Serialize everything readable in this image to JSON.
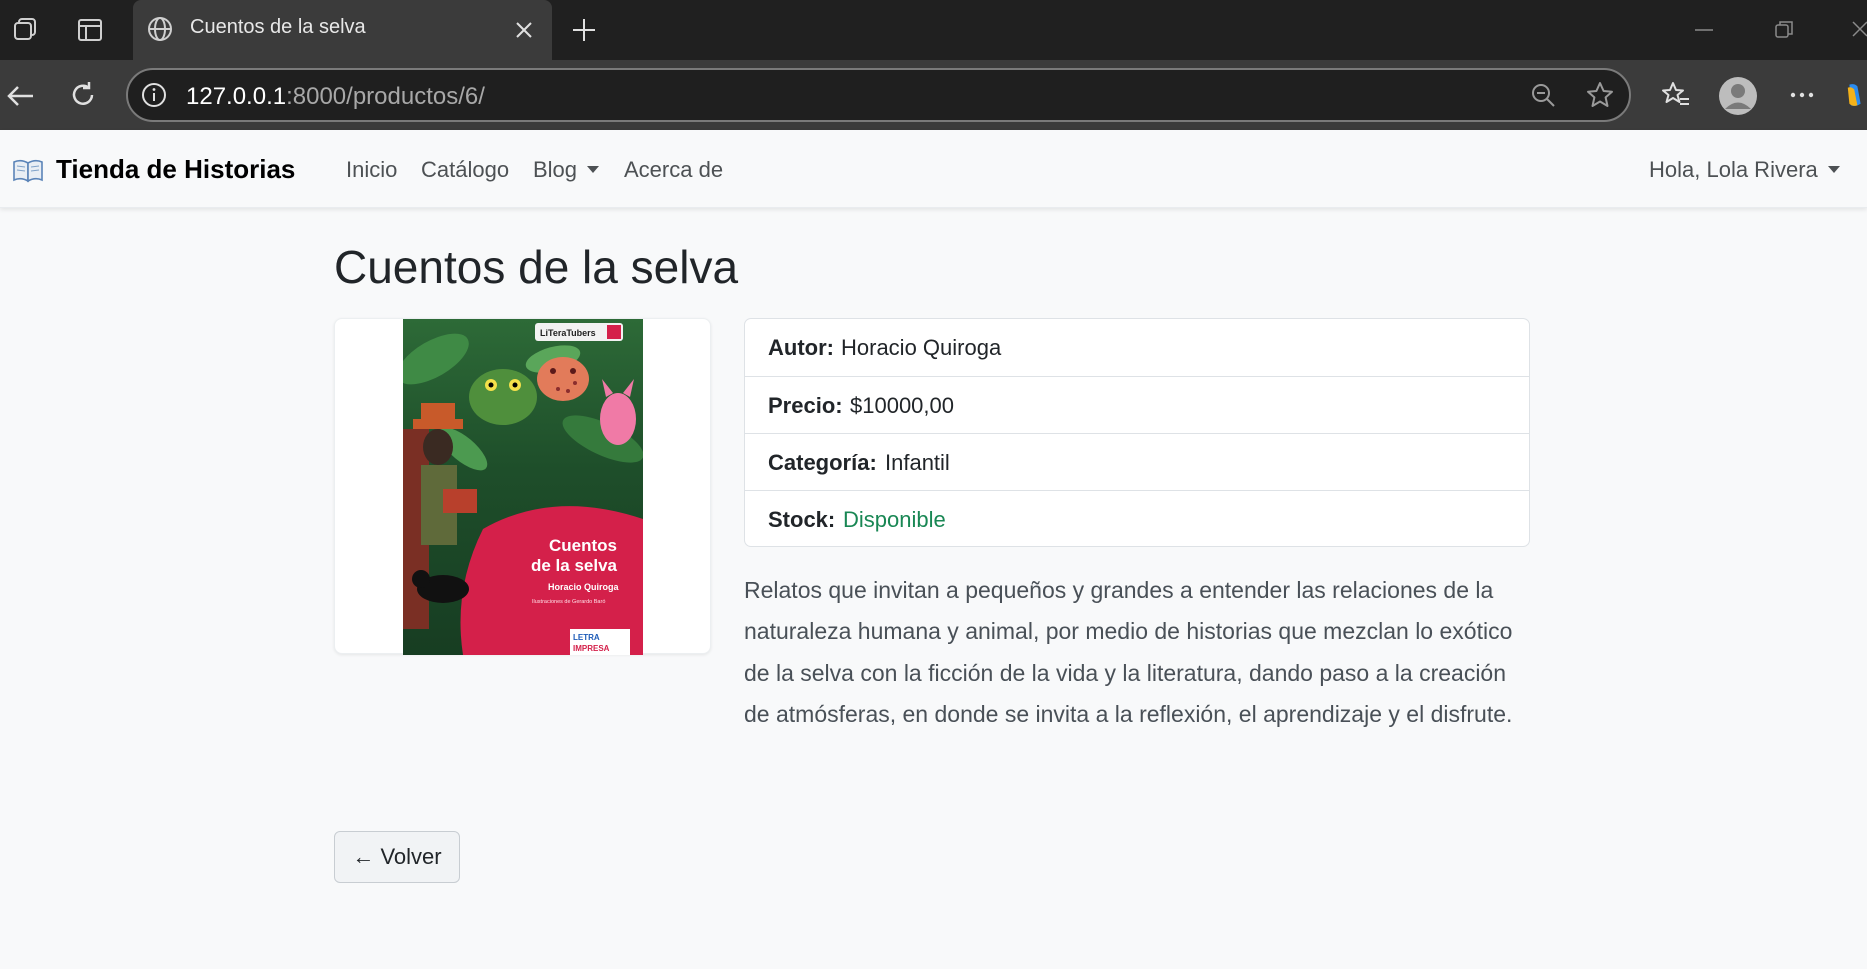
{
  "browser": {
    "tab_title": "Cuentos de la selva",
    "url_host": "127.0.0.1",
    "url_rest": ":8000/productos/6/"
  },
  "navbar": {
    "brand": "Tienda de Historias",
    "links": [
      "Inicio",
      "Catálogo",
      "Blog",
      "Acerca de"
    ],
    "user_menu": "Hola, Lola Rivera"
  },
  "product": {
    "title": "Cuentos de la selva",
    "cover": {
      "badge": "LiTeraTubers",
      "title_line1": "Cuentos",
      "title_line2": "de la selva",
      "author": "Horacio Quiroga",
      "illustrator": "Ilustraciones de Gerardo Baró",
      "publisher_line1": "LETRA",
      "publisher_line2": "IMPRESA"
    },
    "details": [
      {
        "label": "Autor:",
        "value": "Horacio Quiroga"
      },
      {
        "label": "Precio:",
        "value": "$10000,00"
      },
      {
        "label": "Categoría:",
        "value": "Infantil"
      },
      {
        "label": "Stock:",
        "value": "Disponible"
      }
    ],
    "description": "Relatos que invitan a pequeños y grandes a entender las relaciones de la naturaleza humana y animal, por medio de historias que mezclan lo exótico de la selva con la ficción de la vida y la literatura, dando paso a la creación de atmósferas, en donde se invita a la reflexión, el aprendizaje y el disfrute."
  },
  "back_button": "← Volver",
  "colors": {
    "stock_available": "#198754",
    "cover_red": "#d4204a",
    "cover_green": "#1f5a2c"
  },
  "icons": {
    "brand": "open-book-icon",
    "chrome": [
      "workspaces-icon",
      "vertical-tabs-icon",
      "globe-icon",
      "close-icon",
      "plus-icon",
      "back-icon",
      "refresh-icon",
      "info-icon",
      "zoom-out-icon",
      "star-icon",
      "favorites-icon",
      "profile-icon",
      "more-icon",
      "minimize-icon",
      "restore-icon"
    ]
  }
}
